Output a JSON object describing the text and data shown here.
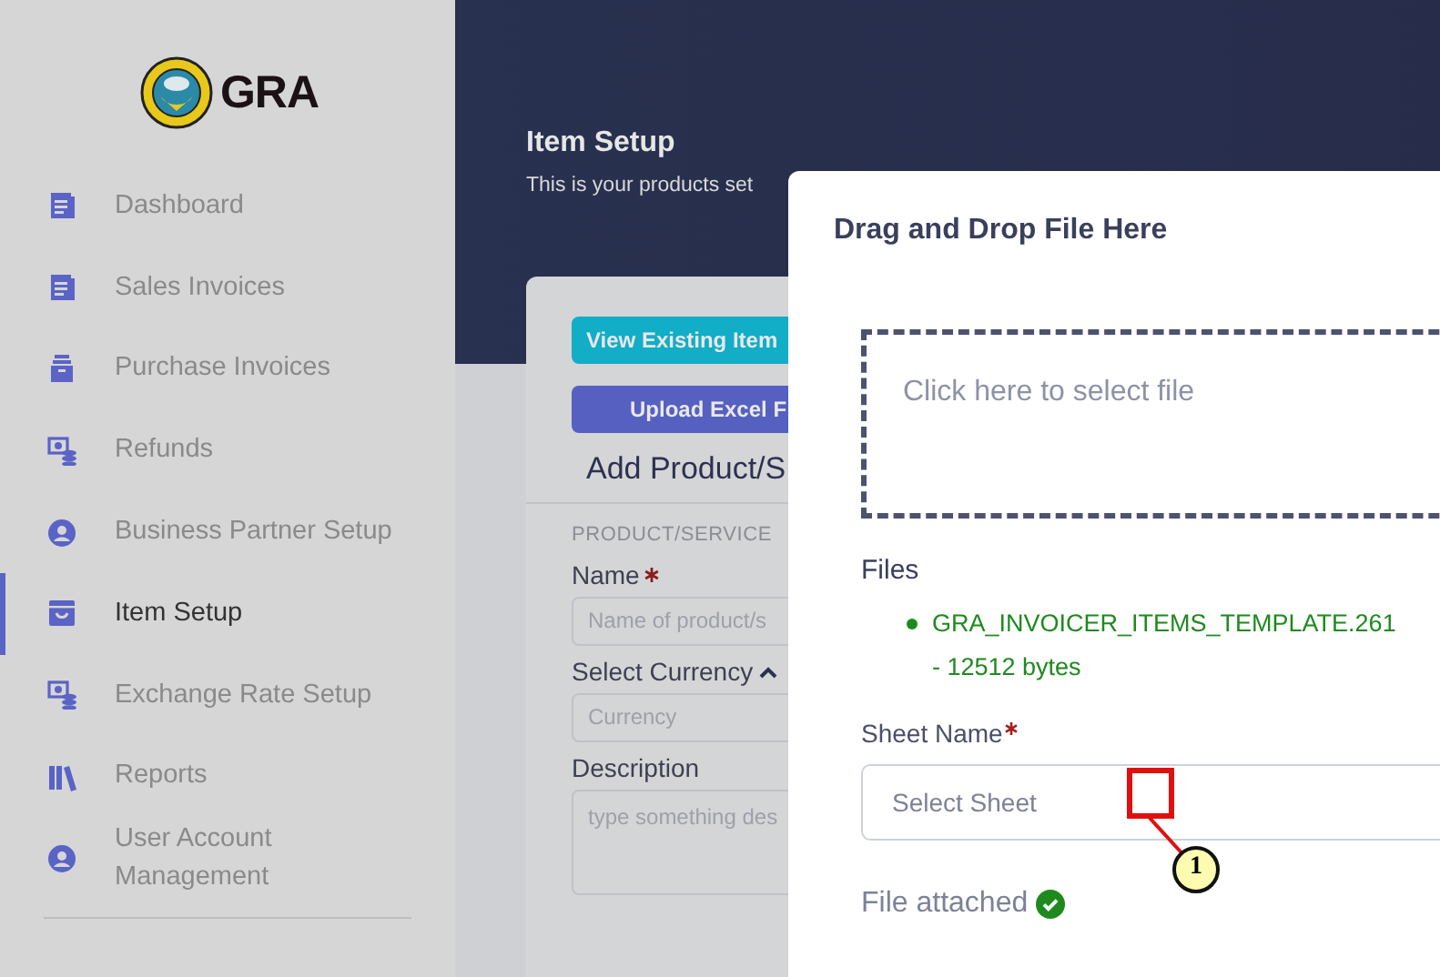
{
  "sidebar": {
    "logo": {
      "text": "GRA"
    },
    "items": [
      {
        "label": "Dashboard",
        "kind": "document",
        "selected": false
      },
      {
        "label": "Sales Invoices",
        "kind": "document",
        "selected": false
      },
      {
        "label": "Purchase Invoices",
        "kind": "archive",
        "selected": false
      },
      {
        "label": "Refunds",
        "kind": "money",
        "selected": false
      },
      {
        "label": "Business Partner Setup",
        "kind": "user",
        "selected": false
      },
      {
        "label": "Item Setup",
        "kind": "box",
        "selected": true
      },
      {
        "label": "Exchange Rate Setup",
        "kind": "money",
        "selected": false
      },
      {
        "label": "Reports",
        "kind": "books",
        "selected": false
      },
      {
        "label": "User Account Management",
        "kind": "user",
        "selected": false
      }
    ]
  },
  "header": {
    "title": "Item Setup",
    "subtitle": "This is your products set"
  },
  "card": {
    "buttons": [
      {
        "label": "View Existing Item",
        "kind": "info"
      },
      {
        "label": "Upload Excel F",
        "kind": "primary"
      }
    ],
    "heading": "Add Product/S",
    "section": "PRODUCT/SERVICE",
    "fields": [
      {
        "label": "Name",
        "required": true,
        "kind": "input",
        "placeholder": "Name of product/s"
      },
      {
        "label": "Select Currency",
        "required": false,
        "kind": "toggle",
        "placeholder": "Currency"
      },
      {
        "label": "Description",
        "required": false,
        "kind": "textarea",
        "placeholder": "type something des"
      }
    ]
  },
  "modal": {
    "title": "Drag and Drop File Here",
    "dropzone": {
      "placeholder": "Click here to select file"
    },
    "files_label": "Files",
    "files": [
      {
        "name": "GRA_INVOICER_ITEMS_TEMPLATE.261",
        "size": "- 12512 bytes"
      }
    ],
    "sheet": {
      "label": "Sheet Name",
      "required": true,
      "placeholder": "Select Sheet"
    },
    "status": {
      "text": "File attached",
      "ok": true
    }
  },
  "annotation": {
    "label": "1"
  }
}
